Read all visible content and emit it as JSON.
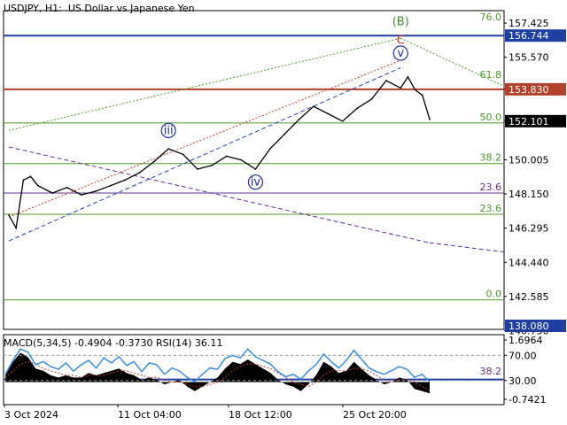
{
  "header": {
    "symbol": "USDJPY",
    "timeframe": "H1",
    "description": "US Dollar vs Japanese Yen"
  },
  "colors": {
    "price_line": "#000000",
    "level_blue": "#1f3fa3",
    "level_red": "#b2412b",
    "fib_green": "#4c9a2a",
    "fib_purple": "#6a2d91",
    "trend_red_dotted": "#d9362b",
    "trend_blue_dashed": "#2840c8",
    "trend_green_dotted": "#4c9a2a",
    "trend_purple_dashed": "#6a2da0",
    "wave_blue": "#1e2f9e",
    "wave_green": "#3f8f2f",
    "wave_red": "#c0392b",
    "rsi_line": "#3a8fe0",
    "macd_hist": "#000000",
    "macd_signal": "#c0392b"
  },
  "chart_data": [
    {
      "type": "line",
      "series_label": "USDJPY H1 close",
      "ylim": [
        140.8,
        158.1
      ],
      "y_ticks": [
        "157.425",
        "155.570",
        "153.830",
        "152.101",
        "150.005",
        "148.150",
        "146.295",
        "144.440",
        "142.585",
        "140.730"
      ],
      "x_ticks": [
        "3 Oct 2024",
        "11 Oct 04:00",
        "18 Oct 12:00",
        "25 Oct 20:00"
      ],
      "x_range": [
        "2024-10-03",
        "2024-11-01"
      ],
      "points": [
        [
          "2024-10-03",
          147.0
        ],
        [
          "2024-10-03 12:00",
          146.3
        ],
        [
          "2024-10-04",
          148.9
        ],
        [
          "2024-10-04 12:00",
          149.1
        ],
        [
          "2024-10-05",
          148.6
        ],
        [
          "2024-10-06",
          148.2
        ],
        [
          "2024-10-07",
          148.5
        ],
        [
          "2024-10-08",
          148.1
        ],
        [
          "2024-10-09",
          148.3
        ],
        [
          "2024-10-10",
          148.6
        ],
        [
          "2024-10-11",
          148.9
        ],
        [
          "2024-10-12",
          149.3
        ],
        [
          "2024-10-13",
          149.9
        ],
        [
          "2024-10-14",
          150.6
        ],
        [
          "2024-10-15",
          150.3
        ],
        [
          "2024-10-16",
          149.5
        ],
        [
          "2024-10-17",
          149.7
        ],
        [
          "2024-10-18",
          150.2
        ],
        [
          "2024-10-19",
          150.0
        ],
        [
          "2024-10-20",
          149.5
        ],
        [
          "2024-10-21",
          150.6
        ],
        [
          "2024-10-22",
          151.4
        ],
        [
          "2024-10-23",
          152.2
        ],
        [
          "2024-10-24",
          152.9
        ],
        [
          "2024-10-25",
          152.5
        ],
        [
          "2024-10-26",
          152.1
        ],
        [
          "2024-10-27",
          152.8
        ],
        [
          "2024-10-28",
          153.3
        ],
        [
          "2024-10-29",
          154.3
        ],
        [
          "2024-10-30",
          153.9
        ],
        [
          "2024-10-30 12:00",
          154.5
        ],
        [
          "2024-10-31",
          153.8
        ],
        [
          "2024-10-31 12:00",
          153.5
        ],
        [
          "2024-11-01",
          152.2
        ]
      ],
      "horizontal_levels": [
        {
          "value": 156.744,
          "label": "156.744",
          "color": "#1f3fa3"
        },
        {
          "value": 153.83,
          "label": "153.830",
          "color": "#b2412b"
        },
        {
          "value": 152.101,
          "label": "152.101",
          "color": "#000000"
        },
        {
          "value": 138.08,
          "label": "138.080",
          "color": "#1f3fa3"
        }
      ],
      "fib_levels": [
        {
          "label": "76.0",
          "value": 157.43,
          "color": "#4c9a2a",
          "line": false
        },
        {
          "label": "61.8",
          "value": 154.3,
          "color": "#4c9a2a",
          "line": false
        },
        {
          "label": "50.0",
          "value": 152.0,
          "color": "#4c9a2a",
          "line": true
        },
        {
          "label": "38.2",
          "value": 149.8,
          "color": "#4c9a2a",
          "line": true
        },
        {
          "label": "23.6",
          "value": 148.2,
          "color": "#6a2d91",
          "line": true
        },
        {
          "label": "23.6",
          "value": 147.05,
          "color": "#4c9a2a",
          "line": true
        },
        {
          "label": "0.0",
          "value": 142.4,
          "color": "#4c9a2a",
          "line": true
        },
        {
          "label": "38.2",
          "value": 138.2,
          "color": "#6a2d91",
          "line": false
        }
      ],
      "wave_labels": [
        {
          "text": "iii",
          "date": "2024-10-14",
          "value": 151.4,
          "color": "#1e2f9e",
          "circled": true
        },
        {
          "text": "iv",
          "date": "2024-10-20",
          "value": 148.6,
          "color": "#1e2f9e",
          "circled": true
        },
        {
          "text": "v",
          "date": "2024-10-30",
          "value": 155.6,
          "color": "#1e2f9e",
          "circled": true
        },
        {
          "text": "C",
          "date": "2024-10-30",
          "value": 156.3,
          "color": "#c0392b",
          "circled": false
        },
        {
          "text": "(B)",
          "date": "2024-10-30",
          "value": 157.3,
          "color": "#3f8f2f",
          "circled": false
        }
      ]
    },
    {
      "type": "line",
      "indicator": "MACD(5,34,5) -0.4904 -0.3730 RSI(14) 36.11",
      "ylim": [
        -1.0,
        2.1
      ],
      "y_ticks": [
        "1.6964",
        "70.00",
        "30.00",
        "-0.7421"
      ],
      "rsi": [
        40,
        62,
        80,
        75,
        55,
        60,
        52,
        48,
        58,
        45,
        55,
        62,
        50,
        66,
        58,
        68,
        54,
        60,
        44,
        58,
        55,
        40,
        50,
        45,
        35,
        28,
        40,
        50,
        48,
        65,
        70,
        66,
        80,
        68,
        62,
        56,
        44,
        36,
        40,
        32,
        45,
        55,
        72,
        60,
        50,
        62,
        78,
        64,
        50,
        44,
        40,
        46,
        52,
        48,
        35,
        40,
        28
      ],
      "macd": [
        0.3,
        0.9,
        1.3,
        1.1,
        0.6,
        0.5,
        0.3,
        0.2,
        0.3,
        0.2,
        0.2,
        0.4,
        0.3,
        0.4,
        0.5,
        0.6,
        0.4,
        0.3,
        0.1,
        0.2,
        0.1,
        -0.1,
        0.0,
        0.1,
        -0.2,
        -0.4,
        -0.2,
        0.0,
        0.2,
        0.6,
        0.9,
        0.8,
        1.0,
        0.8,
        0.6,
        0.4,
        0.1,
        -0.1,
        -0.2,
        -0.4,
        -0.1,
        0.3,
        0.9,
        0.7,
        0.4,
        0.5,
        0.9,
        0.6,
        0.3,
        0.1,
        -0.1,
        0.0,
        0.2,
        0.1,
        -0.3,
        -0.4,
        -0.5
      ],
      "signal": [
        0.2,
        0.5,
        0.8,
        0.9,
        0.8,
        0.6,
        0.5,
        0.4,
        0.3,
        0.3,
        0.2,
        0.3,
        0.3,
        0.3,
        0.4,
        0.5,
        0.5,
        0.4,
        0.3,
        0.2,
        0.2,
        0.1,
        0.0,
        0.0,
        -0.1,
        -0.2,
        -0.2,
        -0.1,
        0.0,
        0.2,
        0.5,
        0.7,
        0.8,
        0.8,
        0.7,
        0.6,
        0.4,
        0.2,
        0.0,
        -0.1,
        -0.2,
        0.0,
        0.3,
        0.5,
        0.5,
        0.5,
        0.6,
        0.6,
        0.5,
        0.3,
        0.1,
        0.0,
        0.1,
        0.1,
        0.0,
        -0.2,
        -0.37
      ]
    }
  ]
}
